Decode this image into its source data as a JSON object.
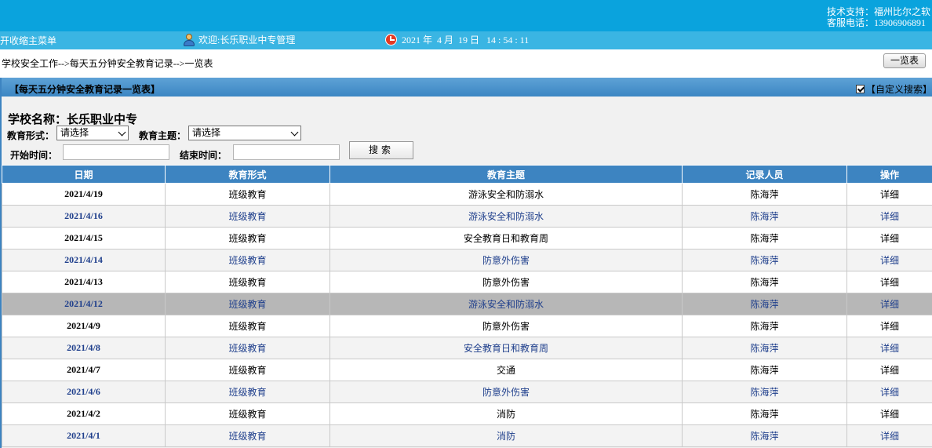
{
  "header": {
    "support_line1": "技术支持：福州比尔之软",
    "support_line2": "客服电话：13906906891",
    "menu_toggle": "开收缩主菜单",
    "welcome": "欢迎:长乐职业中专管理",
    "datetime": "2021 年  4 月  19 日   14 : 54 : 11"
  },
  "breadcrumb": "学校安全工作-->每天五分钟安全教育记录-->一览表",
  "list_button": "一览表",
  "panel": {
    "title": "【每天五分钟安全教育记录一览表】",
    "custom_search": "【自定义搜索】"
  },
  "filters": {
    "school": "学校名称：长乐职业中专",
    "form_label": "教育形式：",
    "form_value": "请选择",
    "topic_label": "教育主题：",
    "topic_value": "请选择",
    "start_label": "开始时间：",
    "end_label": "结束时间：",
    "search_button": "搜索"
  },
  "table": {
    "headers": [
      "日期",
      "教育形式",
      "教育主题",
      "记录人员",
      "操作"
    ],
    "rows": [
      [
        "2021/4/19",
        "班级教育",
        "游泳安全和防溺水",
        "陈海萍",
        "详细"
      ],
      [
        "2021/4/16",
        "班级教育",
        "游泳安全和防溺水",
        "陈海萍",
        "详细"
      ],
      [
        "2021/4/15",
        "班级教育",
        "安全教育日和教育周",
        "陈海萍",
        "详细"
      ],
      [
        "2021/4/14",
        "班级教育",
        "防意外伤害",
        "陈海萍",
        "详细"
      ],
      [
        "2021/4/13",
        "班级教育",
        "防意外伤害",
        "陈海萍",
        "详细"
      ],
      [
        "2021/4/12",
        "班级教育",
        "游泳安全和防溺水",
        "陈海萍",
        "详细"
      ],
      [
        "2021/4/9",
        "班级教育",
        "防意外伤害",
        "陈海萍",
        "详细"
      ],
      [
        "2021/4/8",
        "班级教育",
        "安全教育日和教育周",
        "陈海萍",
        "详细"
      ],
      [
        "2021/4/7",
        "班级教育",
        "交通",
        "陈海萍",
        "详细"
      ],
      [
        "2021/4/6",
        "班级教育",
        "防意外伤害",
        "陈海萍",
        "详细"
      ],
      [
        "2021/4/2",
        "班级教育",
        "消防",
        "陈海萍",
        "详细"
      ],
      [
        "2021/4/1",
        "班级教育",
        "消防",
        "陈海萍",
        "详细"
      ]
    ]
  },
  "icons": {
    "user": "user-icon",
    "clock": "clock-icon",
    "checkbox": "checkbox-checked-icon"
  }
}
